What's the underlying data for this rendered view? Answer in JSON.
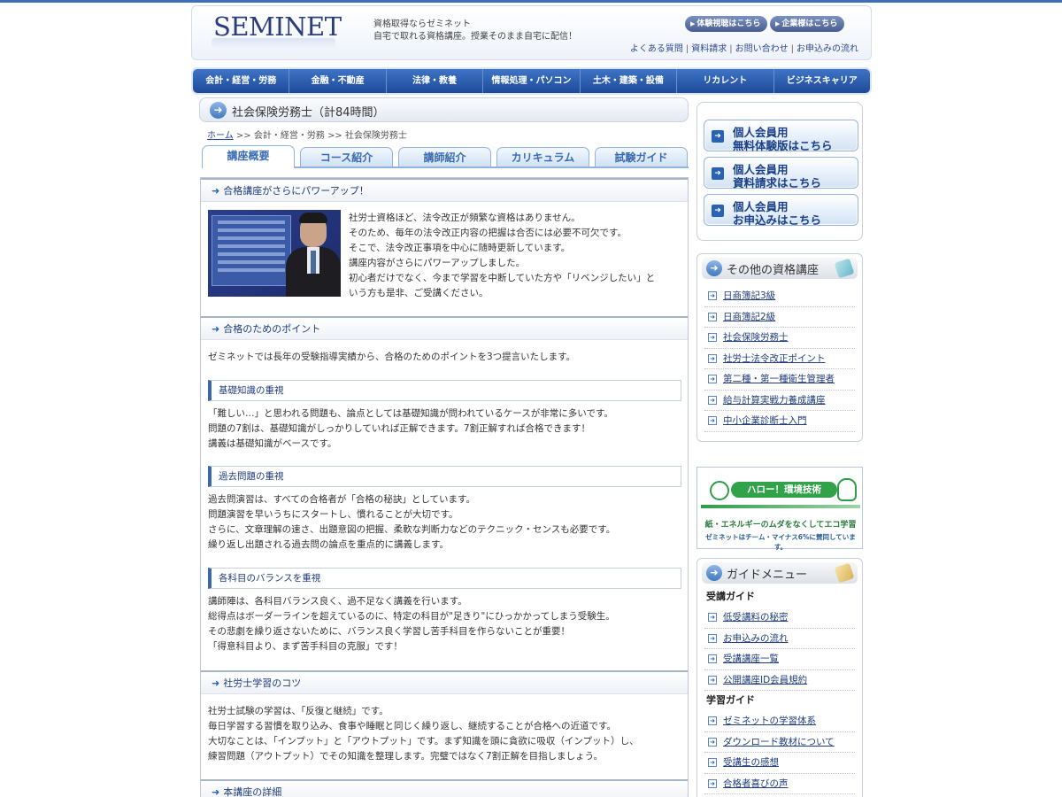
{
  "header": {
    "logo": "SEMINET",
    "tagline_1": "資格取得ならゼミネット",
    "tagline_2": "自宅で取れる資格講座。授業そのまま自宅に配信！",
    "btn_trial": "体験視聴はこちら",
    "btn_corp": "企業様はこちら",
    "links": [
      "よくある質問",
      "資料請求",
      "お問い合わせ",
      "お申込みの流れ"
    ]
  },
  "nav": [
    "会計・経営・労務",
    "金融・不動産",
    "法律・教養",
    "情報処理・パソコン",
    "土木・建築・設備",
    "リカレント",
    "ビジネスキャリア"
  ],
  "page": {
    "title": "社会保険労務士（計84時間）",
    "breadcrumb_home": "ホーム",
    "breadcrumb_rest": " >> 会計・経営・労務 >> 社会保険労務士"
  },
  "tabs": [
    "講座概要",
    "コース紹介",
    "講師紹介",
    "カリキュラム",
    "試験ガイド"
  ],
  "sections": {
    "s1": {
      "title": "合格講座がさらにパワーアップ！",
      "lines": [
        "社労士資格ほど、法令改正が頻繁な資格はありません。",
        "そのため、毎年の法令改正内容の把握は合否には必要不可欠です。",
        "そこで、法令改正事項を中心に随時更新しています。",
        "講座内容がさらにパワーアップしました。",
        "初心者だけでなく、今まで学習を中断していた方や「リベンジしたい」と",
        "いう方も是非、ご受講ください。"
      ]
    },
    "s2": {
      "title": "合格のためのポイント",
      "intro": "ゼミネットでは長年の受験指導実績から、合格のためのポイントを3つ提言いたします。",
      "p1_title": "基礎知識の重視",
      "p1_lines": [
        "「難しい…」と思われる問題も、論点としては基礎知識が問われているケースが非常に多いです。",
        "問題の7割は、基礎知識がしっかりしていれば正解できます。7割正解すれば合格できます！",
        "講義は基礎知識がベースです。"
      ],
      "p2_title": "過去問題の重視",
      "p2_lines": [
        "過去問演習は、すべての合格者が「合格の秘訣」としています。",
        "問題演習を早いうちにスタートし、慣れることが大切です。",
        "さらに、文章理解の速さ、出題意図の把握、柔軟な判断力などのテクニック・センスも必要です。",
        "繰り返し出題される過去問の論点を重点的に講義します。"
      ],
      "p3_title": "各科目のバランスを重視",
      "p3_lines": [
        "講師陣は、各科目バランス良く、過不足なく講義を行います。",
        "総得点はボーダーラインを超えているのに、特定の科目が\"足きり\"にひっかかってしまう受験生。",
        "その悲劇を繰り返さないために、バランス良く学習し苦手科目を作らないことが重要！",
        "「得意科目より、まず苦手科目の克服」です！"
      ]
    },
    "s3": {
      "title": "社労士学習のコツ",
      "lines": [
        "社労士試験の学習は、「反復と継続」です。",
        "毎日学習する習慣を取り込み、食事や睡眠と同じく繰り返し、継続することが合格への近道です。",
        "大切なことは、「インプット」と「アウトプット」です。まず知識を頭に貪欲に吸収（インプット）し、",
        "練習問題（アウトプット）でその知識を整理します。完璧ではなく7割正解を目指しましょう。"
      ]
    },
    "s4": {
      "title": "本講座の詳細"
    }
  },
  "sidebar": {
    "btn1": [
      "個人会員用",
      "無料体験版はこちら"
    ],
    "btn2": [
      "個人会員用",
      "資料請求はこちら"
    ],
    "btn3": [
      "個人会員用",
      "お申込みはこちら"
    ],
    "other_title": "その他の資格講座",
    "other_links": [
      "日商簿記3級",
      "日商簿記2級",
      "社会保険労務士",
      "社労士法令改正ポイント",
      "第二種・第一種衛生管理者",
      "給与計算実戦力養成講座",
      "中小企業診断士入門"
    ],
    "eco_hello": "ハロー！環境技術",
    "eco_sub1": "紙・エネルギーのムダをなくしてエコ学習",
    "eco_sub2": "ゼミネットはチーム・マイナス6%に賛同しています。",
    "guide_title": "ガイドメニュー",
    "guide_cat1": "受講ガイド",
    "guide_links1": [
      "低受講料の秘密",
      "お申込みの流れ",
      "受講講座一覧",
      "公開講座ID会員規約"
    ],
    "guide_cat2": "学習ガイド",
    "guide_links2": [
      "ゼミネットの学習体系",
      "ダウンロード教材について",
      "受講生の感想",
      "合格者喜びの声"
    ]
  }
}
